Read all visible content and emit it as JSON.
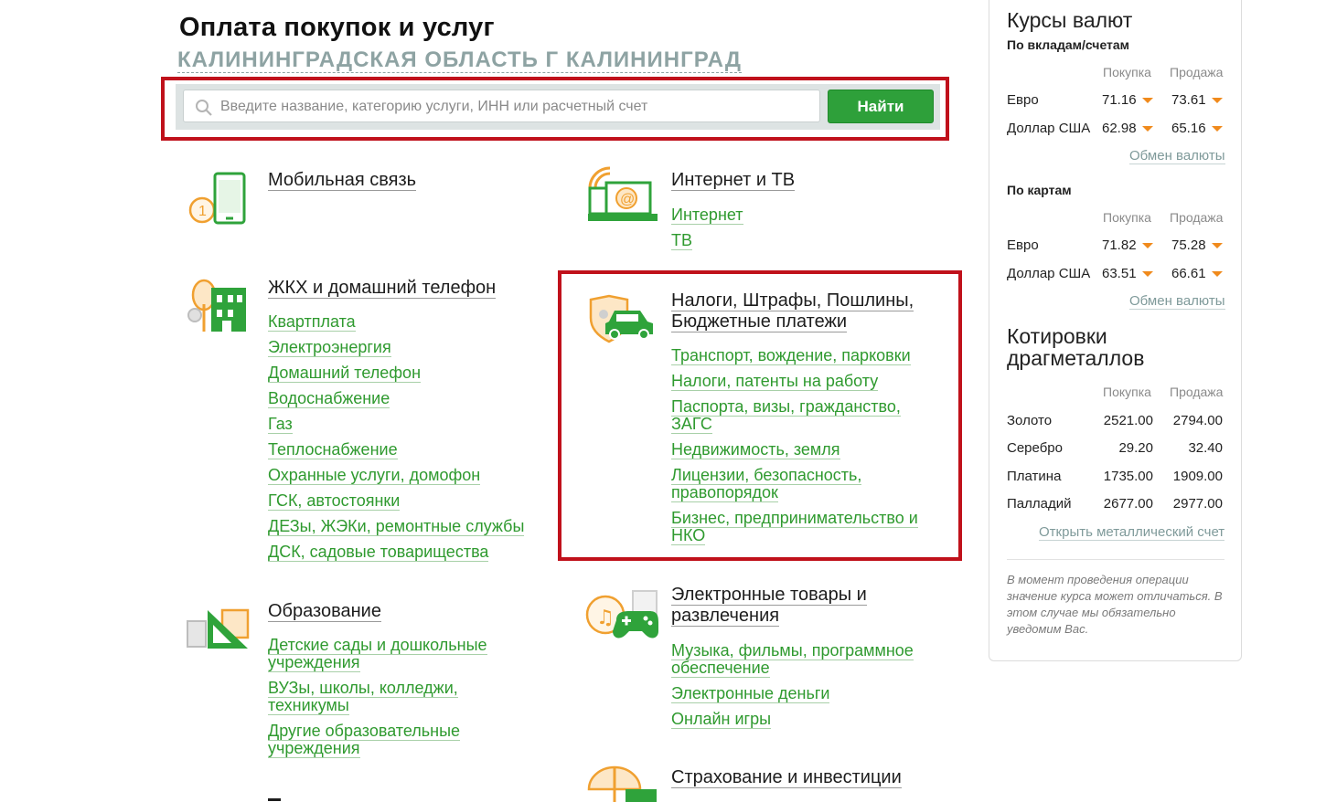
{
  "header": {
    "title": "Оплата покупок и услуг",
    "region": "КАЛИНИНГРАДСКАЯ ОБЛАСТЬ Г КАЛИНИНГРАД"
  },
  "search": {
    "placeholder": "Введите название, категорию услуги, ИНН или расчетный счет",
    "button": "Найти"
  },
  "categories": {
    "mobile": {
      "title": "Мобильная связь",
      "icon": "mobile-phone-icon"
    },
    "internet": {
      "title": "Интернет и ТВ",
      "icon": "laptop-at-icon",
      "links": [
        "Интернет",
        "ТВ"
      ]
    },
    "housing": {
      "title": "ЖКХ и домашний телефон",
      "icon": "house-tree-icon",
      "links": [
        "Квартплата",
        "Электроэнергия",
        "Домашний телефон",
        "Водоснабжение",
        "Газ",
        "Теплоснабжение",
        "Охранные услуги, домофон",
        "ГСК, автостоянки",
        "ДЕЗы, ЖЭКи, ремонтные службы",
        "ДСК, садовые товарищества"
      ]
    },
    "taxes": {
      "title_line1": "Налоги, Штрафы, Пошлины,",
      "title_line2": "Бюджетные платежи",
      "icon": "car-shield-icon",
      "links": [
        "Транспорт, вождение, парковки",
        "Налоги, патенты на работу",
        "Паспорта, визы, гражданство, ЗАГС",
        "Недвижимость, земля",
        "Лицензии, безопасность, правопорядок",
        "Бизнес, предпринимательство и НКО"
      ]
    },
    "education": {
      "title": "Образование",
      "icon": "ruler-triangle-icon",
      "links": [
        "Детские сады и дошкольные учреждения",
        "ВУЗы, школы, колледжи, техникумы",
        "Другие образовательные учреждения"
      ]
    },
    "electronic": {
      "title_line1": "Электронные товары и",
      "title_line2": "развлечения",
      "icon": "gamepad-music-icon",
      "links": [
        "Музыка, фильмы, программное обеспечение",
        "Электронные деньги",
        "Онлайн игры"
      ]
    },
    "insurance": {
      "title": "Страхование и инвестиции",
      "icon": "umbrella-case-icon"
    }
  },
  "sidebar": {
    "rates_title": "Курсы валют",
    "deposits_label": "По вкладам/счетам",
    "cards_label": "По картам",
    "buy": "Покупка",
    "sell": "Продажа",
    "deposits": [
      {
        "name": "Евро",
        "buy": "71.16",
        "sell": "73.61"
      },
      {
        "name": "Доллар США",
        "buy": "62.98",
        "sell": "65.16"
      }
    ],
    "cards": [
      {
        "name": "Евро",
        "buy": "71.82",
        "sell": "75.28"
      },
      {
        "name": "Доллар США",
        "buy": "63.51",
        "sell": "66.61"
      }
    ],
    "exchange_link": "Обмен валюты",
    "metals_title_line1": "Котировки",
    "metals_title_line2": "драгметаллов",
    "metals": [
      {
        "name": "Золото",
        "buy": "2521.00",
        "sell": "2794.00"
      },
      {
        "name": "Серебро",
        "buy": "29.20",
        "sell": "32.40"
      },
      {
        "name": "Платина",
        "buy": "1735.00",
        "sell": "1909.00"
      },
      {
        "name": "Палладий",
        "buy": "2677.00",
        "sell": "2977.00"
      }
    ],
    "metal_account_link": "Открыть металлический счет",
    "note": "В момент проведения операции значение курса может отличаться. В этом случае мы обязательно уведомим Вас."
  },
  "colors": {
    "accent_green": "#2f9a2f",
    "button_green": "#2ea03a",
    "highlight_red": "#c0111b",
    "arrow_orange": "#f08a1c"
  }
}
